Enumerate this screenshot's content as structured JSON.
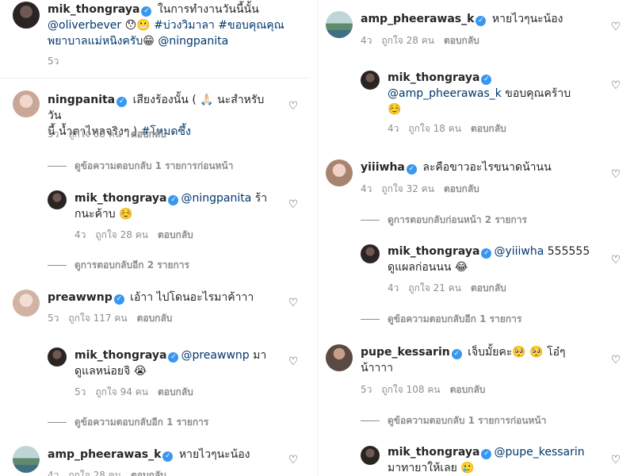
{
  "left": {
    "c1": {
      "user": "mik_thongraya",
      "t1": " ในการทำงานวันนี้นั้น",
      "mention1": "@oliverbever",
      "e1": "😯😬",
      "tag1": "#บ่วงวิมาลา",
      "tag2": "#ขอบคุณคุณ",
      "tag2b": "พยาบาลแม่หนิงครับ",
      "e2": "😁",
      "mention2": "@ningpanita",
      "time": "5ว"
    },
    "c2": {
      "user": "ningpanita",
      "t1": " เสียงร้องนั้น ( 🙏🏻 นะสำหรับวัน",
      "t2": "นี้ น้ำตาไหลจริงๆ ) ",
      "tag": "#โหมดซึ้ง",
      "time": "5ว",
      "likes": "ถูกใจ 68 คน",
      "reply": "ตอบกลับ"
    },
    "t1": "ดูข้อความตอบกลับ 1 รายการก่อนหน้า",
    "r1": {
      "user": "mik_thongraya",
      "mention": "@ningpanita",
      "t1": " ร้า",
      "t2": "กนะค้าบ ☺️",
      "time": "4ว",
      "likes": "ถูกใจ 28 คน",
      "reply": "ตอบกลับ"
    },
    "t2": "ดูการตอบกลับอีก 2 รายการ",
    "c3": {
      "user": "preawwnp",
      "t1": " เอ้าา ไปโดนอะไรมาค้าาา",
      "time": "5ว",
      "likes": "ถูกใจ 117 คน",
      "reply": "ตอบกลับ"
    },
    "r2": {
      "user": "mik_thongraya",
      "mention": "@preawwnp",
      "t1": " มา",
      "t2": "ดูแลหน่อยจิ 😭",
      "time": "5ว",
      "likes": "ถูกใจ 94 คน",
      "reply": "ตอบกลับ"
    },
    "t3": "ดูข้อความตอบกลับอีก 1 รายการ",
    "c4": {
      "user": "amp_pheerawas_k",
      "t1": " หายไวๆนะน้อง",
      "time": "4ว",
      "likes": "ถูกใจ 28 คน",
      "reply": "ตอบกลับ"
    }
  },
  "right": {
    "c1": {
      "user": "amp_pheerawas_k",
      "t1": " หายไวๆนะน้อง",
      "time": "4ว",
      "likes": "ถูกใจ 28 คน",
      "reply": "ตอบกลับ"
    },
    "r1": {
      "user": "mik_thongraya",
      "mention": "@amp_pheerawas_k",
      "t1": " ขอบคุณคร้าบ",
      "e": "☺️",
      "time": "4ว",
      "likes": "ถูกใจ 18 คน",
      "reply": "ตอบกลับ"
    },
    "c2": {
      "user": "yiiiwha",
      "t1": " ละคือขาวอะไรขนาดน้านน",
      "time": "4ว",
      "likes": "ถูกใจ 32 คน",
      "reply": "ตอบกลับ"
    },
    "t1": "ดูการตอบกลับก่อนหน้า 2 รายการ",
    "r2": {
      "user": "mik_thongraya",
      "mention": "@yiiiwha",
      "t1": " 555555",
      "t2": "ดูแผลก่อนนน 😂",
      "time": "4ว",
      "likes": "ถูกใจ 21 คน",
      "reply": "ตอบกลับ"
    },
    "t2": "ดูข้อความตอบกลับอีก 1 รายการ",
    "c3": {
      "user": "pupe_kessarin",
      "t1": " เจ็บมั้ยคะ🥺 🥺  โอ๋ๆ",
      "t2": "น้าาาา",
      "time": "5ว",
      "likes": "ถูกใจ 108 คน",
      "reply": "ตอบกลับ"
    },
    "t3": "ดูข้อความตอบกลับ 1 รายการก่อนหน้า",
    "r3": {
      "user": "mik_thongraya",
      "mention": "@pupe_kessarin",
      "t2": "มาทายาให้เลย 🥲"
    }
  },
  "icons": {
    "heart": "heart-icon",
    "verified": "verified-badge-icon"
  },
  "colors": {
    "link": "#00376b",
    "meta": "#8e8e8e",
    "verified": "#3897f0"
  }
}
